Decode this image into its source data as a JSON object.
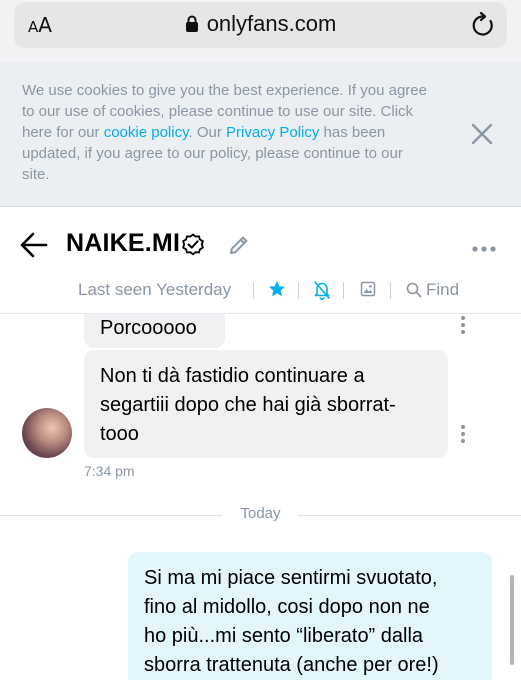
{
  "browser": {
    "aa_label_small": "A",
    "aa_label_large": "A",
    "url": "onlyfans.com"
  },
  "cookie_banner": {
    "text_1": "We use cookies to give you the best experience. If you agree to our use of cookies, please continue to use our site. Click here for our ",
    "cookie_policy_link": "cookie policy",
    "text_2": ". Our ",
    "privacy_policy_link": "Privacy Policy",
    "text_3": " has been updated, if you agree to our policy, please continue to our site."
  },
  "chat": {
    "contact_name": "NAIKE.MI",
    "last_seen": "Last seen Yesterday",
    "find_label": "Find",
    "icons": [
      "back-arrow-icon",
      "verified-icon",
      "edit-pencil-icon",
      "more-icon",
      "star-icon",
      "bell-off-icon",
      "image-icon",
      "search-icon"
    ],
    "accent_color": "#00aff0"
  },
  "messages": {
    "incoming_1": "Porcooooo",
    "incoming_2_line_1": "Non ti dà fastidio continuare a",
    "incoming_2_line_2": "segartiii dopo che hai già sborrat-",
    "incoming_2_line_3": "tooo",
    "incoming_time": "7:34 pm",
    "date_divider": "Today",
    "outgoing_1_line_1": "Si ma mi piace sentirmi svuotato,",
    "outgoing_1_line_2": "fino al midollo, cosi dopo non ne",
    "outgoing_1_line_3": "ho più...mi sento “liberato” dalla",
    "outgoing_1_line_4": "sborra trattenuta (anche per ore!)"
  }
}
